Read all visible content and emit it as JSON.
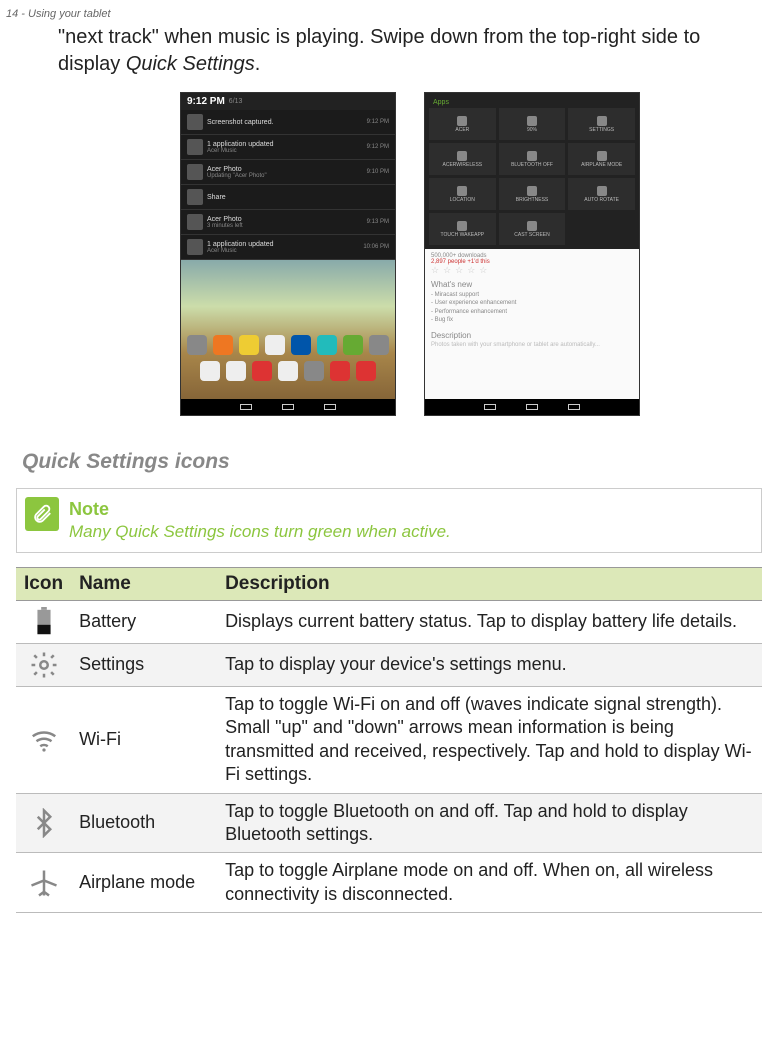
{
  "page_header": "14 - Using your tablet",
  "intro": {
    "part1": "\"next track\" when music is playing. Swipe down from the top-right side to display ",
    "italic": "Quick Settings",
    "part2": "."
  },
  "screenshot_left": {
    "time": "9:12 PM",
    "date": "6/13",
    "notifications": [
      {
        "title": "Screenshot captured.",
        "sub": "",
        "right": "9:12 PM"
      },
      {
        "title": "1 application updated",
        "sub": "Acer Music",
        "right": "9:12 PM"
      },
      {
        "title": "Acer Photo",
        "sub": "Updating \"Acer Photo\"",
        "right": "9:10 PM"
      },
      {
        "title": "Share",
        "sub": "",
        "right": ""
      },
      {
        "title": "Acer Photo",
        "sub": "3 minutes left",
        "right": "9:13 PM"
      },
      {
        "title": "1 application updated",
        "sub": "Acer Music",
        "right": "10:06 PM"
      }
    ]
  },
  "screenshot_right": {
    "apps_label": "Apps",
    "tiles": [
      {
        "label": "ACER"
      },
      {
        "label": "90%"
      },
      {
        "label": "SETTINGS"
      },
      {
        "label": "ACERWIRELESS"
      },
      {
        "label": "BLUETOOTH OFF"
      },
      {
        "label": "AIRPLANE MODE"
      },
      {
        "label": "LOCATION"
      },
      {
        "label": "BRIGHTNESS"
      },
      {
        "label": "AUTO ROTATE"
      },
      {
        "label": "TOUCH WAKEAPP"
      },
      {
        "label": "CAST SCREEN"
      }
    ],
    "downloads_a": "500,000+ downloads",
    "downloads_b": "2,897 people +1'd this",
    "whatsnew_title": "What's new",
    "whatsnew_items": [
      "- Miracast support",
      "- User experience enhancement",
      "- Performance enhancement",
      "- Bug fix"
    ],
    "description_title": "Description",
    "description_blurb": "Photos taken with your smartphone or tablet are automatically..."
  },
  "section_heading": "Quick Settings icons",
  "note": {
    "title": "Note",
    "body": "Many Quick Settings icons turn green when active."
  },
  "table": {
    "head": {
      "c1": "Icon",
      "c2": "Name",
      "c3": "Description"
    },
    "rows": [
      {
        "name": "Battery",
        "desc": "Displays current battery status. Tap to display battery life details."
      },
      {
        "name": "Settings",
        "desc": "Tap to display your device's settings menu."
      },
      {
        "name": "Wi-Fi",
        "desc": "Tap to toggle Wi-Fi on and off (waves indicate signal strength). Small \"up\" and \"down\" arrows mean information is being transmitted and received, respectively. Tap and hold to display Wi-Fi settings."
      },
      {
        "name": "Bluetooth",
        "desc": "Tap to toggle Bluetooth on and off. Tap and hold to display Bluetooth settings."
      },
      {
        "name": "Airplane mode",
        "desc": "Tap to toggle Airplane mode on and off. When on, all wireless connectivity is disconnected."
      }
    ]
  }
}
